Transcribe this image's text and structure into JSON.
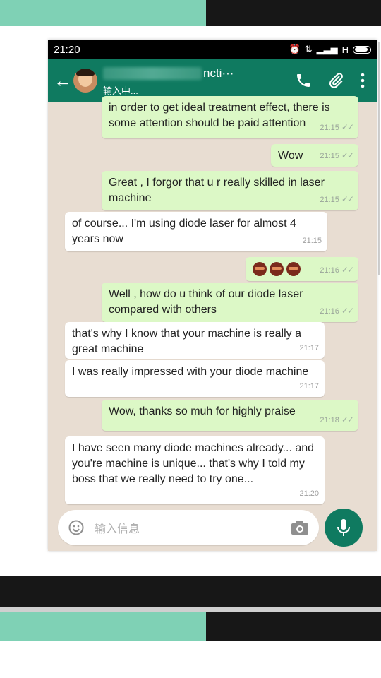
{
  "statusbar": {
    "time": "21:20",
    "network": "H"
  },
  "header": {
    "contact_name_visible": "ncti···",
    "status": "输入中..."
  },
  "messages": [
    {
      "dir": "out",
      "text": "in order to get ideal treatment effect, there is some attention should be paid attention",
      "time": "21:15"
    },
    {
      "dir": "out",
      "text": "Wow",
      "time": "21:15"
    },
    {
      "dir": "out",
      "text": "Great , I forgor that u r really skilled in laser machine",
      "time": "21:15"
    },
    {
      "dir": "in",
      "text": "of course... I'm using diode laser for almost 4 years now",
      "time": "21:15"
    },
    {
      "dir": "out",
      "text": "",
      "time": "21:16",
      "emoji_count": 3
    },
    {
      "dir": "out",
      "text": "Well , how do u think of our diode laser compared with others",
      "time": "21:16"
    },
    {
      "dir": "in",
      "text": "that's why I know that your machine is really a great machine",
      "time": "21:17"
    },
    {
      "dir": "in",
      "text": "I was really impressed with your diode machine",
      "time": "21:17"
    },
    {
      "dir": "out",
      "text": "Wow, thanks so muh for highly praise",
      "time": "21:18"
    },
    {
      "dir": "in",
      "text": "I have seen many diode machines already... and you're machine is unique... that's why I told my boss that we really need to try one...",
      "time": "21:20"
    }
  ],
  "input": {
    "placeholder": "输入信息"
  },
  "colors": {
    "header": "#0f7a60",
    "outgoing": "#dcf8c6",
    "incoming": "#ffffff",
    "chat_bg": "#e8ddd2",
    "mint_band": "#7fd1b5"
  }
}
